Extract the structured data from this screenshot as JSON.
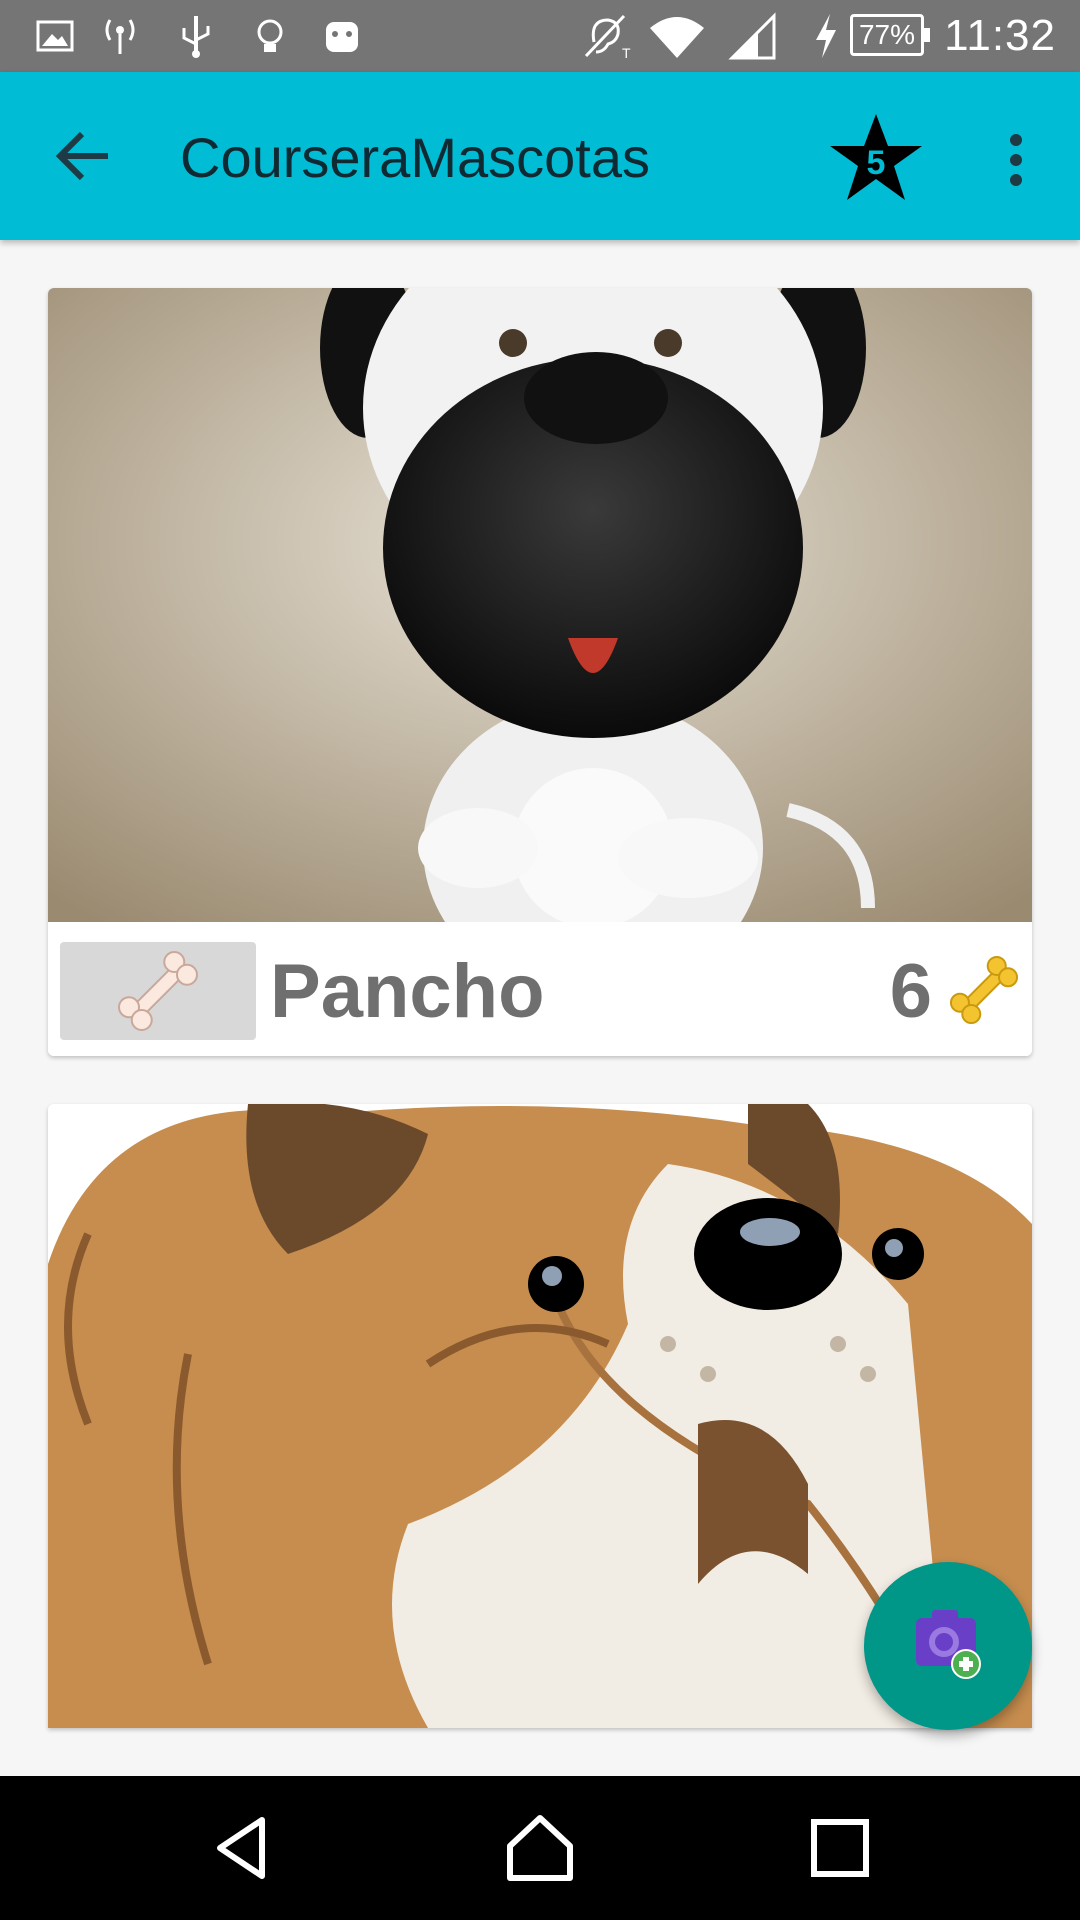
{
  "status_bar": {
    "time": "11:32",
    "battery": "77%",
    "icons": [
      "gallery-icon",
      "wireless-icon",
      "usb-icon",
      "bulb-icon",
      "android-icon",
      "hearing-aid-icon",
      "wifi-icon",
      "signal-icon",
      "charging-icon"
    ]
  },
  "app_bar": {
    "title": "CourseraMascotas",
    "star_count": "5",
    "icons": {
      "back": "arrow-back-icon",
      "star": "star-icon",
      "menu": "overflow-menu-icon"
    },
    "color": "#00bcd4"
  },
  "pets": [
    {
      "name": "Pancho",
      "likes": "6",
      "image": "pug-cartoon-photo"
    },
    {
      "name": "",
      "likes": "",
      "image": "bulldog-cartoon-photo"
    }
  ],
  "fab": {
    "icon": "add-photo-camera-icon",
    "color": "#009688"
  },
  "nav_bar": {
    "buttons": [
      "back-triangle-icon",
      "home-circle-icon",
      "recents-square-icon"
    ]
  }
}
